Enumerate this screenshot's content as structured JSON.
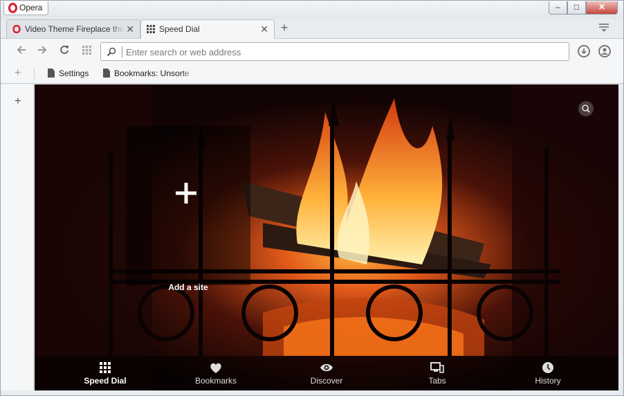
{
  "window": {
    "app_button": "Opera",
    "controls": {
      "minimize": "–",
      "maximize": "□",
      "close": "✕"
    }
  },
  "tabs": [
    {
      "label": "Video Theme Fireplace the",
      "active": false
    },
    {
      "label": "Speed Dial",
      "active": true
    }
  ],
  "new_tab_label": "+",
  "address_bar": {
    "placeholder": "Enter search or web address",
    "value": ""
  },
  "bookmarks_bar": {
    "items": [
      {
        "label": "Settings"
      },
      {
        "label": "Bookmarks: Unsorte"
      }
    ]
  },
  "speed_dial": {
    "add_site_label": "Add a site"
  },
  "bottom_nav": [
    {
      "label": "Speed Dial",
      "icon": "grid-icon",
      "active": true
    },
    {
      "label": "Bookmarks",
      "icon": "heart-icon",
      "active": false
    },
    {
      "label": "Discover",
      "icon": "eye-icon",
      "active": false
    },
    {
      "label": "Tabs",
      "icon": "devices-icon",
      "active": false
    },
    {
      "label": "History",
      "icon": "clock-icon",
      "active": false
    }
  ],
  "colors": {
    "opera_red": "#d9202a",
    "fire_orange": "#ff8a1c",
    "close_red": "#c9453a"
  }
}
